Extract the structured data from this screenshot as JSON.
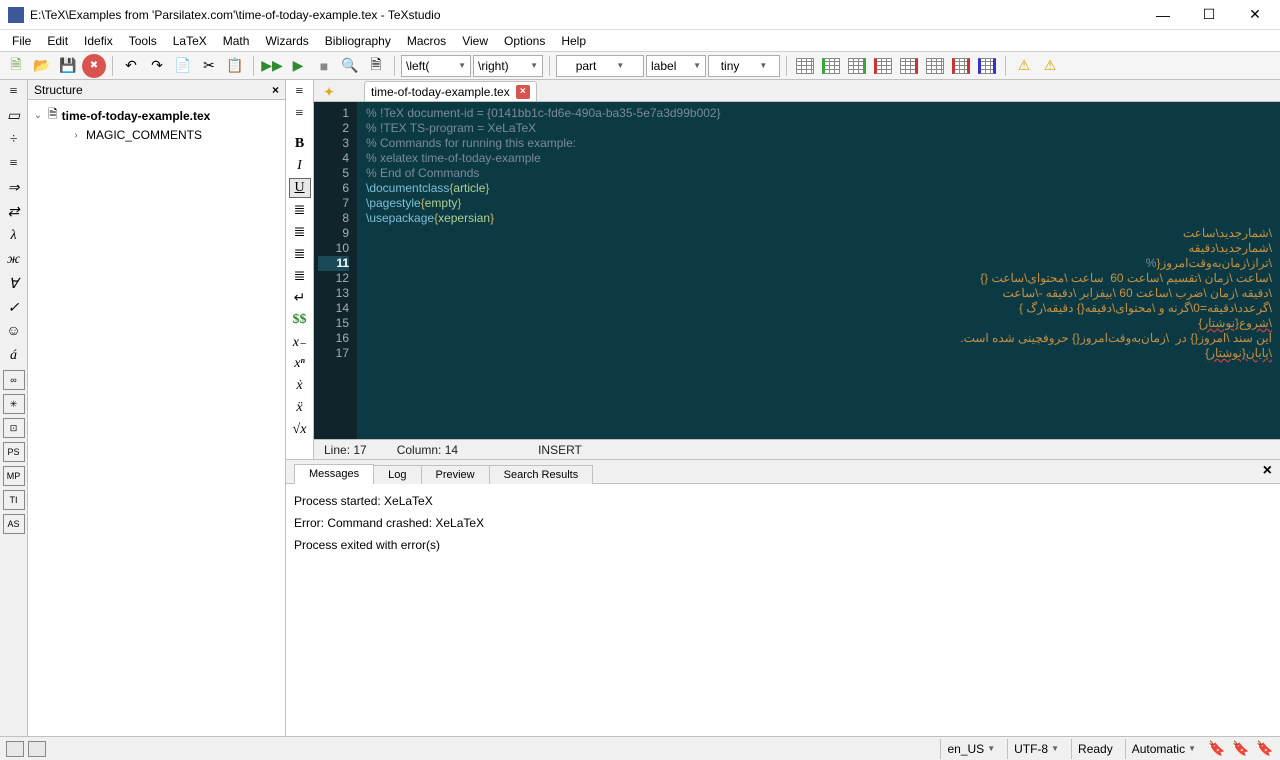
{
  "window": {
    "title": "E:\\TeX\\Examples from 'Parsilatex.com'\\time-of-today-example.tex - TeXstudio"
  },
  "menu": [
    "File",
    "Edit",
    "Idefix",
    "Tools",
    "LaTeX",
    "Math",
    "Wizards",
    "Bibliography",
    "Macros",
    "View",
    "Options",
    "Help"
  ],
  "combos": {
    "left": "\\left(",
    "right": "\\right)",
    "part": "part",
    "label": "label",
    "tiny": "tiny"
  },
  "structure": {
    "title": "Structure",
    "root": "time-of-today-example.tex",
    "child": "MAGIC_COMMENTS"
  },
  "tab": {
    "name": "time-of-today-example.tex"
  },
  "gutter": [
    "1",
    "2",
    "3",
    "4",
    "5",
    "6",
    "7",
    "8",
    "9",
    "10",
    "11",
    "12",
    "13",
    "14",
    "15",
    "16",
    "17"
  ],
  "code": {
    "l1": "% !TeX document-id = {0141bb1c-fd6e-490a-ba35-5e7a3d99b002}",
    "l2": "% !TEX TS-program = XeLaTeX",
    "l3": "% Commands for running this example:",
    "l4": "% xelatex time-of-today-example",
    "l5": "% End of Commands",
    "l6_cmd": "\\documentclass",
    "l6_arg": "article",
    "l7_cmd": "\\pagestyle",
    "l7_arg": "empty",
    "l8_cmd": "\\usepackage",
    "l8_arg": "xepersian",
    "l9": "\\شمارجدید\\ساعت",
    "l10": "\\شمارجدید\\دقیقه",
    "l11a": "\\تراز\\زمان‌به‌وقت‌امروز{",
    "l11b": "%",
    "l12": "\\ساعت \\زمان \\تقسیم \\ساعت 60  ساعت \\محتوای\\ساعت {}",
    "l13": "\\دقیقه \\زمان \\ضرب \\ساعت 60 \\بیفزابر \\دقیقه -\\ساعت",
    "l14": "\\گرعدد\\دقیقه=0\\گرنه و \\محتوای\\دقیقه{} دقیقه\\رگ }",
    "l15": "\\شروع{نوشتار}",
    "l16": "این سند \\امروز{} در  \\زمان‌به‌وقت‌امروز{} حروفچینی شده است.",
    "l17": "\\پایان{نوشتار}"
  },
  "status": {
    "line": "Line: 17",
    "col": "Column: 14",
    "mode": "INSERT"
  },
  "bottom_tabs": [
    "Messages",
    "Log",
    "Preview",
    "Search Results"
  ],
  "messages": [
    "Process started: XeLaTeX",
    "Error: Command crashed: XeLaTeX",
    "Process exited with error(s)"
  ],
  "statusbar": {
    "lang": "en_US",
    "enc": "UTF-8",
    "ready": "Ready",
    "auto": "Automatic"
  },
  "left_icons": [
    "≡",
    "▭",
    "÷",
    "≡",
    "⇒",
    "⇄",
    "λ",
    "ж",
    "∀",
    "✓",
    "☺",
    "á",
    "∞",
    "✳",
    "⊡",
    "PS",
    "MP",
    "TI",
    "AS"
  ],
  "ed_icons_top": [
    "≡",
    "≡"
  ],
  "ed_icons": [
    "B",
    "I",
    "U",
    "≣",
    "≣",
    "≣",
    "≣",
    "↵",
    "$$",
    "x₋",
    "xⁿ",
    "ẋ",
    "ẍ",
    "√x"
  ]
}
